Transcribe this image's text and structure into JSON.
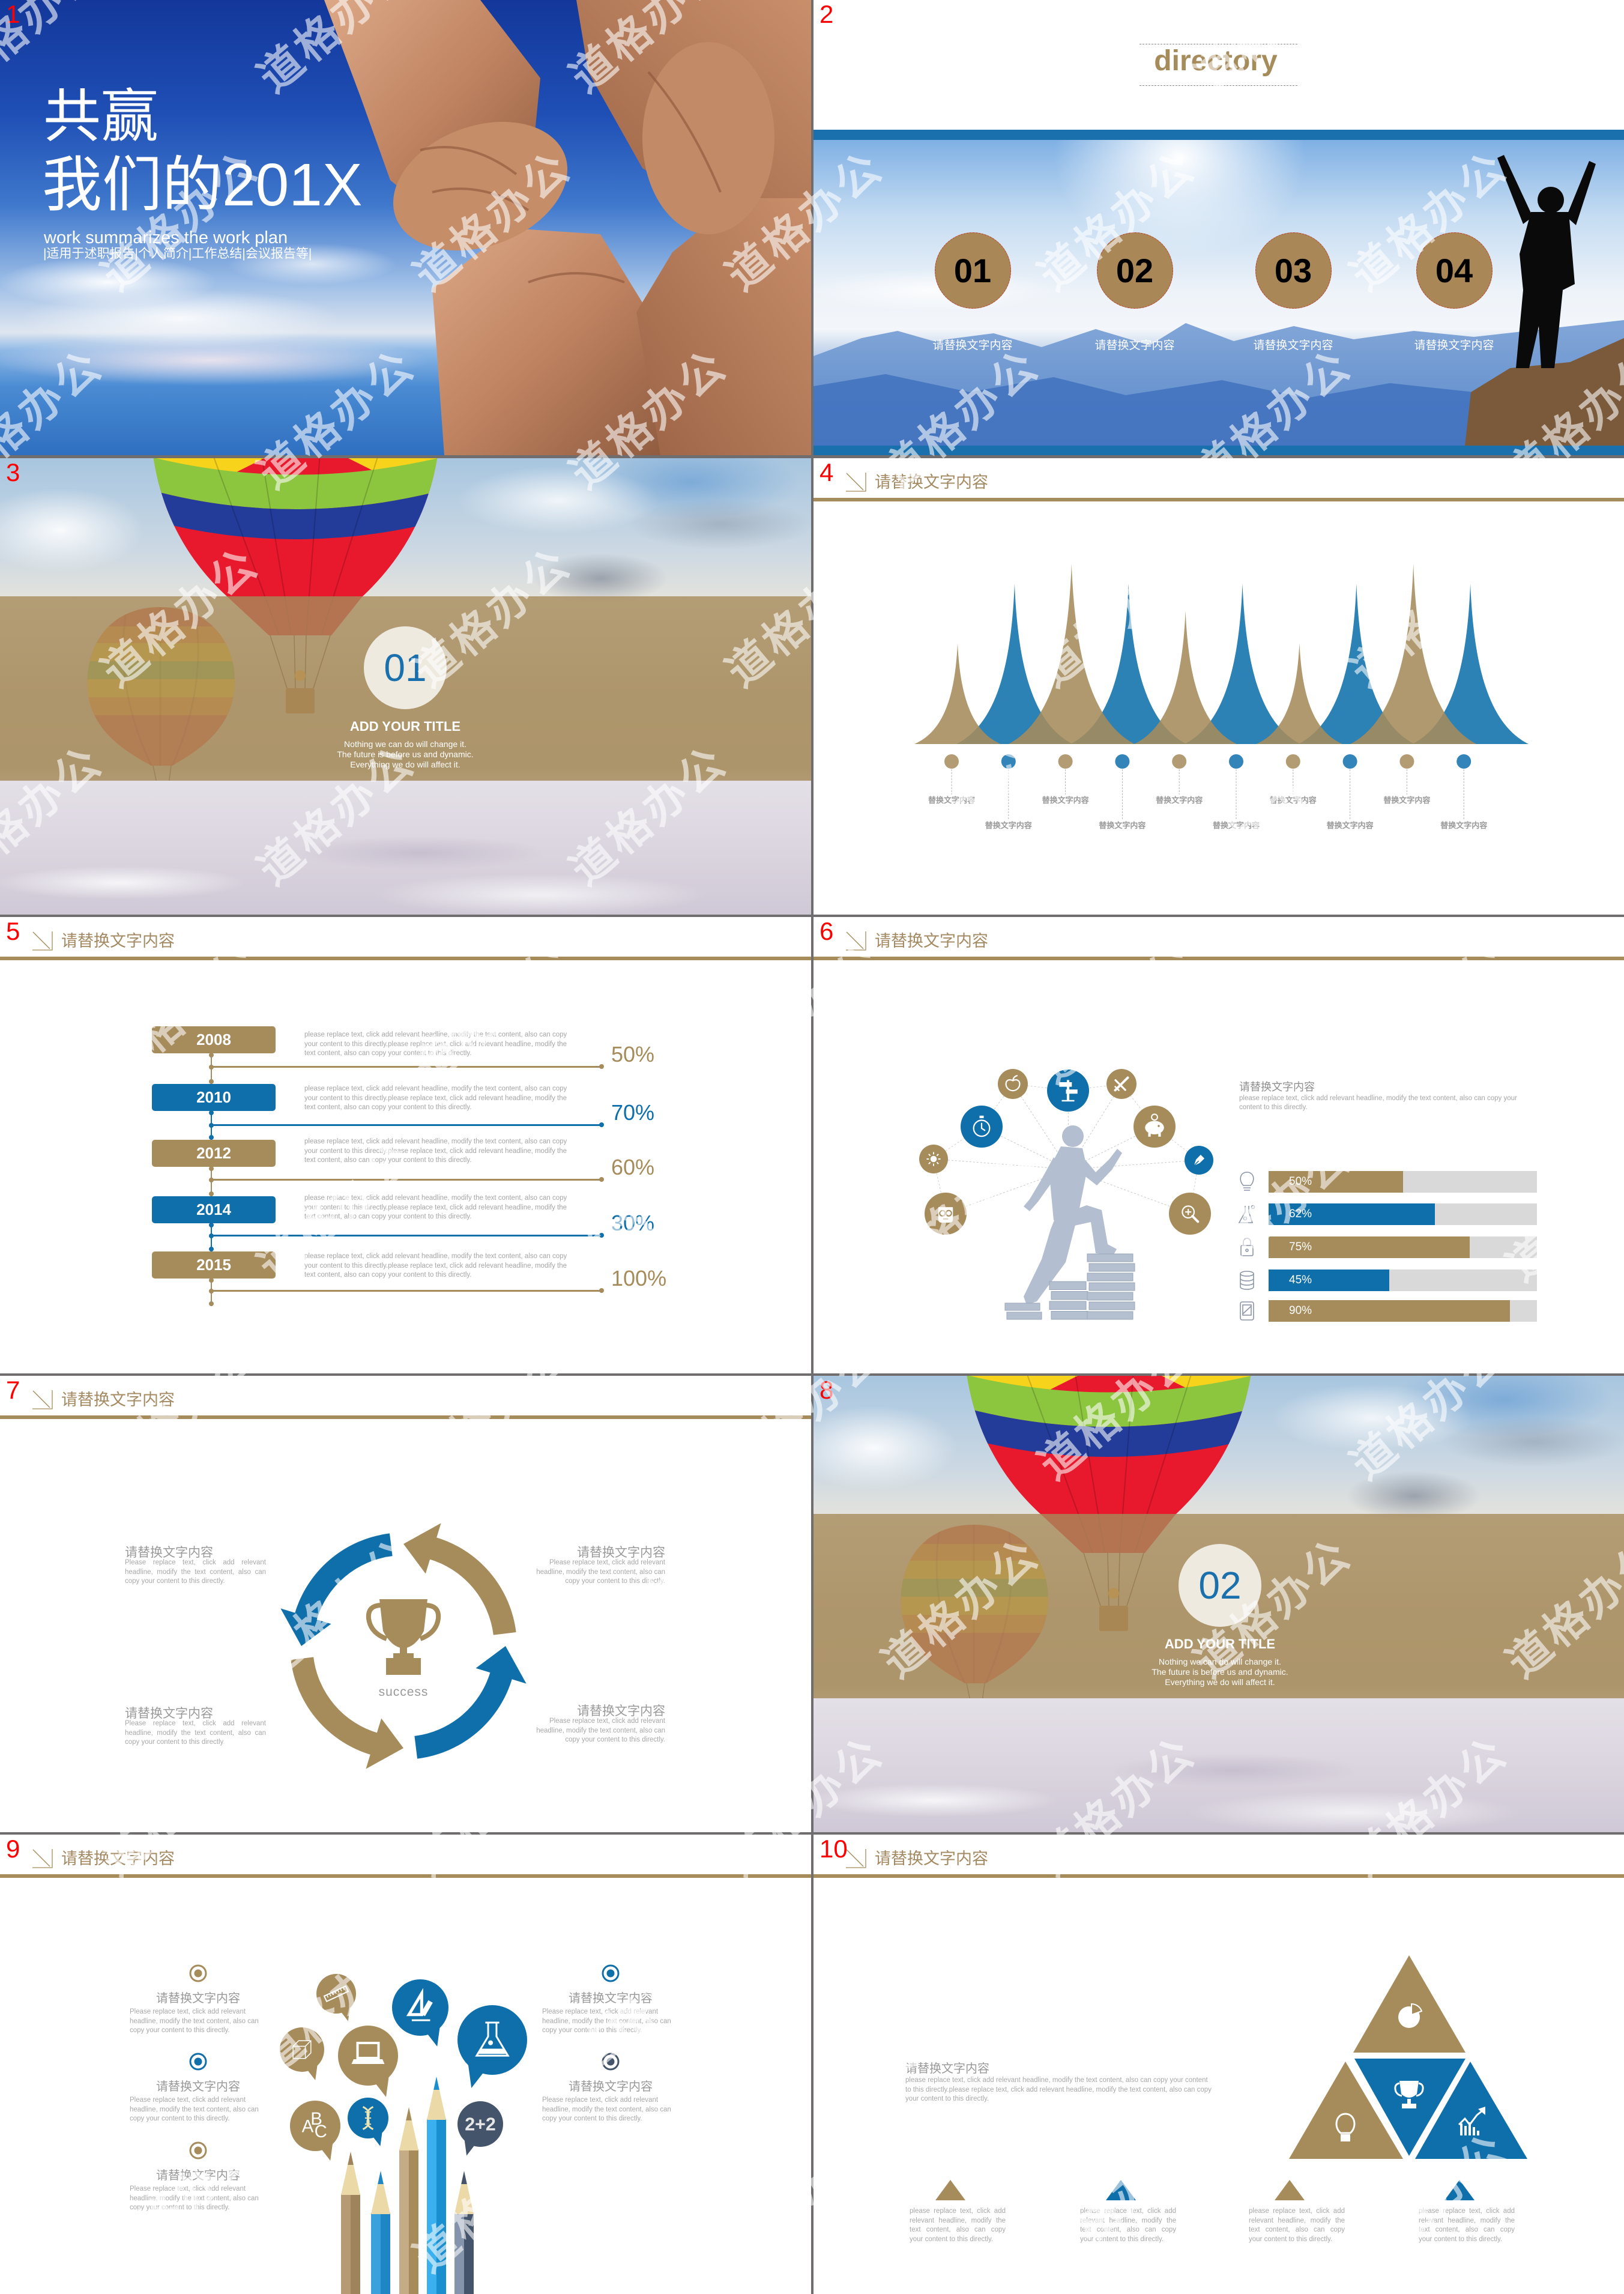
{
  "watermark": {
    "text": "道格办公"
  },
  "theme": {
    "brown": "#a68b5b",
    "blue": "#0f6fab",
    "slate": "#44546a",
    "number_red": "#ff0000",
    "text_gray": "#9b9b9b"
  },
  "slide1": {
    "number": "1",
    "title_line1": "共赢",
    "title_line2": "我们的201X",
    "subtitle_en": "work summarizes the work plan",
    "subtitle_cn": "|适用于述职报告|个人简介|工作总结|会议报告等|"
  },
  "slide2": {
    "number": "2",
    "heading": "directory",
    "items": [
      {
        "num": "01",
        "label": "请替换文字内容"
      },
      {
        "num": "02",
        "label": "请替换文字内容"
      },
      {
        "num": "03",
        "label": "请替换文字内容"
      },
      {
        "num": "04",
        "label": "请替换文字内容"
      }
    ]
  },
  "slide3": {
    "number": "3",
    "section_num": "01",
    "title": "ADD YOUR TITLE",
    "lines": [
      "Nothing we can do will change it.",
      "The future is before us and dynamic.",
      "Everything we do will affect it."
    ]
  },
  "slide4": {
    "number": "4",
    "header": "请替换文字内容",
    "peaks": [
      {
        "color": "brown",
        "height": 0.56,
        "label": "替换文字内容"
      },
      {
        "color": "blue",
        "height": 0.89,
        "label": "替换文字内容"
      },
      {
        "color": "brown",
        "height": 1.0,
        "label": "替换文字内容"
      },
      {
        "color": "blue",
        "height": 0.89,
        "label": "替换文字内容"
      },
      {
        "color": "brown",
        "height": 0.74,
        "label": "替换文字内容"
      },
      {
        "color": "blue",
        "height": 0.89,
        "label": "替换文字内容"
      },
      {
        "color": "brown",
        "height": 0.56,
        "label": "替换文字内容"
      },
      {
        "color": "blue",
        "height": 0.89,
        "label": "替换文字内容"
      },
      {
        "color": "brown",
        "height": 1.0,
        "label": "替换文字内容"
      },
      {
        "color": "blue",
        "height": 0.89,
        "label": "替换文字内容"
      }
    ]
  },
  "slide5": {
    "number": "5",
    "header": "请替换文字内容",
    "rows": [
      {
        "year": "2008",
        "percent": "50%",
        "value": 50,
        "color": "brown",
        "text": "please replace text, click add relevant headline, modify the text content, also can copy your content to this directly.please replace text, click add relevant headline, modify the text content, also can copy your content to this directly."
      },
      {
        "year": "2010",
        "percent": "70%",
        "value": 70,
        "color": "blue",
        "text": "please replace text, click add relevant headline, modify the text content, also can copy your content to this directly.please replace text, click add relevant headline, modify the text content, also can copy your content to this directly."
      },
      {
        "year": "2012",
        "percent": "60%",
        "value": 60,
        "color": "brown",
        "text": "please replace text, click add relevant headline, modify the text content, also can copy your content to this directly.please replace text, click add relevant headline, modify the text content, also can copy your content to this directly."
      },
      {
        "year": "2014",
        "percent": "30%",
        "value": 30,
        "color": "blue",
        "text": "please replace text, click add relevant headline, modify the text content, also can copy your content to this directly.please replace text, click add relevant headline, modify the text content, also can copy your content to this directly."
      },
      {
        "year": "2015",
        "percent": "100%",
        "value": 100,
        "color": "brown",
        "text": "please replace text, click add relevant headline, modify the text content, also can copy your content to this directly.please replace text, click add relevant headline, modify the text content, also can copy your content to this directly."
      }
    ]
  },
  "slide6": {
    "number": "6",
    "header": "请替换文字内容",
    "title": "请替换文字内容",
    "body": "please replace text, click add relevant headline, modify the text content, also can copy your content to this directly.",
    "bars": [
      {
        "icon": "lightbulb",
        "value": 50,
        "label": "50%",
        "color": "brown"
      },
      {
        "icon": "flask",
        "value": 62,
        "label": "62%",
        "color": "blue"
      },
      {
        "icon": "lock",
        "value": 75,
        "label": "75%",
        "color": "brown"
      },
      {
        "icon": "database",
        "value": 45,
        "label": "45%",
        "color": "blue"
      },
      {
        "icon": "tablet",
        "value": 90,
        "label": "90%",
        "color": "brown"
      }
    ],
    "hub_icons": [
      {
        "icon": "apple",
        "color": "brown"
      },
      {
        "icon": "signpost",
        "color": "blue"
      },
      {
        "icon": "airplane",
        "color": "brown"
      },
      {
        "icon": "stopwatch",
        "color": "blue"
      },
      {
        "icon": "piggy-bank",
        "color": "brown"
      },
      {
        "icon": "sun",
        "color": "brown"
      },
      {
        "icon": "pen",
        "color": "blue"
      },
      {
        "icon": "nerd-face",
        "color": "brown"
      },
      {
        "icon": "magnifier",
        "color": "brown"
      }
    ]
  },
  "slide7": {
    "number": "7",
    "header": "请替换文字内容",
    "center_label": "success",
    "arrows": [
      {
        "color": "brown"
      },
      {
        "color": "blue"
      },
      {
        "color": "brown"
      },
      {
        "color": "blue"
      }
    ],
    "blocks": [
      {
        "title": "请替换文字内容",
        "body": "Please replace text, click add relevant headline, modify the text content, also can copy your content to this directly."
      },
      {
        "title": "请替换文字内容",
        "body": "Please replace text, click add relevant headline, modify the text content, also can copy your content to this directly."
      },
      {
        "title": "请替换文字内容",
        "body": "Please replace text, click add relevant headline, modify the text content, also can copy your content to this directly."
      },
      {
        "title": "请替换文字内容",
        "body": "Please replace text, click add relevant headline, modify the text content, also can copy your content to this directly."
      }
    ]
  },
  "slide8": {
    "number": "8",
    "section_num": "02",
    "title": "ADD YOUR TITLE",
    "lines": [
      "Nothing we can do will change it.",
      "The future is before us and dynamic.",
      "Everything we do will affect it."
    ]
  },
  "slide9": {
    "number": "9",
    "header": "请替换文字内容",
    "left": [
      {
        "title": "请替换文字内容",
        "body": "Please replace text, click add relevant headline, modify the text content, also can copy your content to this directly.",
        "marker_color": "brown"
      },
      {
        "title": "请替换文字内容",
        "body": "Please replace text, click add relevant headline, modify the text content, also can copy your content to this directly.",
        "marker_color": "blue"
      },
      {
        "title": "请替换文字内容",
        "body": "Please replace text, click add relevant headline, modify the text content, also can copy your content to this directly.",
        "marker_color": "brown"
      }
    ],
    "right": [
      {
        "title": "请替换文字内容",
        "body": "Please replace text, click add relevant headline, modify the text content, also can copy your content to this directly.",
        "marker_color": "blue"
      },
      {
        "title": "请替换文字内容",
        "body": "Please replace text, click add relevant headline, modify the text content, also can copy your content to this directly.",
        "marker_color": "slate"
      }
    ],
    "bubbles": [
      {
        "icon": "ruler",
        "color": "brown"
      },
      {
        "icon": "set-square",
        "color": "blue"
      },
      {
        "icon": "flask",
        "color": "blue"
      },
      {
        "icon": "cube",
        "color": "brown"
      },
      {
        "icon": "laptop",
        "color": "brown"
      },
      {
        "icon": "letters",
        "color": "brown",
        "text": [
          "A",
          "B",
          "C"
        ]
      },
      {
        "icon": "dna",
        "color": "blue"
      },
      {
        "icon": "math",
        "color": "slate",
        "text": "2+2"
      }
    ],
    "pencils": [
      {
        "color": "#b59a74",
        "shade": "#9f835c"
      },
      {
        "color": "#3aa1dc",
        "shade": "#1f86c4"
      },
      {
        "color": "#c5ab86",
        "shade": "#a68b5b"
      },
      {
        "color": "#3bb0ee",
        "shade": "#1a8fd0"
      },
      {
        "color": "#8494ad",
        "shade": "#44546a"
      }
    ]
  },
  "slide10": {
    "number": "10",
    "header": "请替换文字内容",
    "title": "请替换文字内容",
    "body": "please replace text, click add relevant headline, modify the text content, also can copy your content to this directly.please replace text, click add relevant headline, modify the text content, also can copy your content to this directly.",
    "pyramid": [
      {
        "icon": "pie-chart",
        "color": "brown"
      },
      {
        "icon": "lightbulb",
        "color": "brown"
      },
      {
        "icon": "trophy",
        "color": "blue"
      },
      {
        "icon": "growth-chart",
        "color": "blue"
      }
    ],
    "columns": [
      {
        "color": "brown",
        "body": "please replace text, click add relevant headline, modify the text content, also can copy your content to this directly."
      },
      {
        "color": "blue",
        "body": "please replace text, click add relevant headline, modify the text content, also can copy your content to this directly."
      },
      {
        "color": "brown",
        "body": "please replace text, click add relevant headline, modify the text content, also can copy your content to this directly."
      },
      {
        "color": "blue",
        "body": "please replace text, click add relevant headline, modify the text content, also can copy your content to this directly."
      }
    ]
  }
}
